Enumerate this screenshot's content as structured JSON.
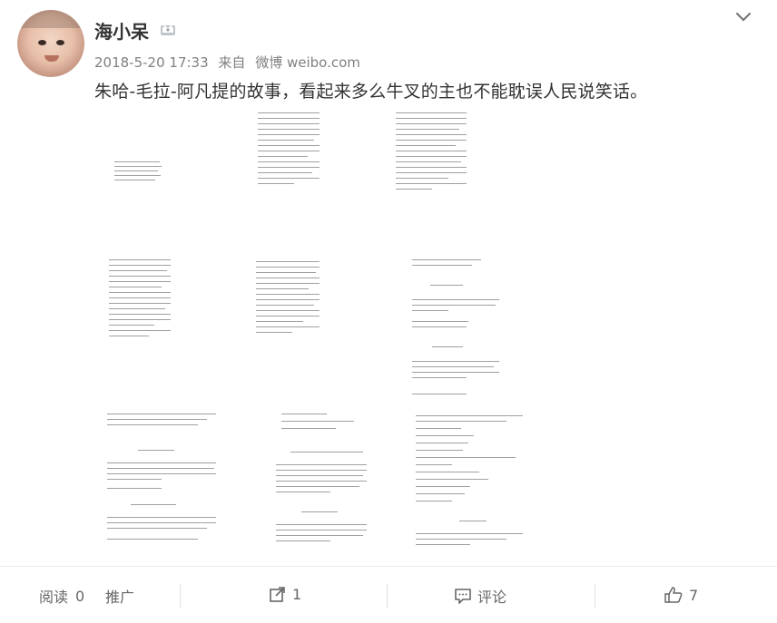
{
  "user": {
    "name": "海小呆",
    "badge_icon": "crown-icon"
  },
  "post": {
    "date": "2018-5-20 17:33",
    "source_prefix": "来自",
    "source": "微博 weibo.com",
    "text": "朱哈-毛拉-阿凡提的故事，看起来多么牛叉的主也不能耽误人民说笑话。"
  },
  "images": [
    {
      "heading": ""
    },
    {
      "heading": ""
    },
    {
      "heading": ""
    },
    {
      "heading": ""
    },
    {
      "heading": ""
    },
    {
      "heading": "衡量荣誉的尺度"
    },
    {
      "heading": "现 金 被 偷"
    },
    {
      "heading": "第三十年是谁的财物"
    },
    {
      "heading": "带   娃"
    }
  ],
  "footer": {
    "read_label": "阅读",
    "read_count": "0",
    "promote_label": "推广",
    "share_count": "1",
    "comment_label": "评论",
    "like_count": "7"
  }
}
